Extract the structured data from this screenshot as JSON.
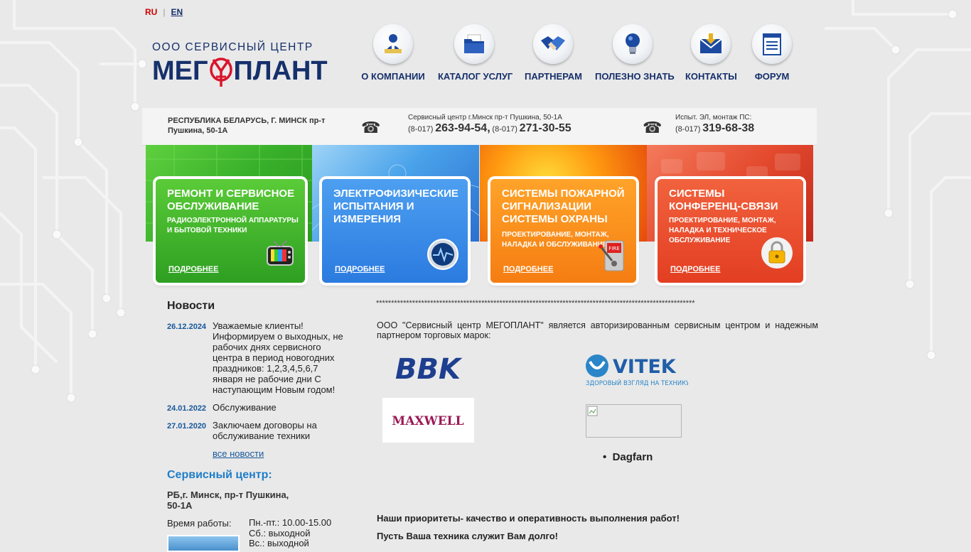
{
  "lang": {
    "ru": "RU",
    "en": "EN"
  },
  "logo": {
    "top": "ООО СЕРВИСНЫЙ ЦЕНТР",
    "left": "МЕГ",
    "right": "ПЛАНТ"
  },
  "nav": [
    {
      "label": "О КОМПАНИИ",
      "icon": "presenter-icon"
    },
    {
      "label": "КАТАЛОГ УСЛУГ",
      "icon": "folder-icon"
    },
    {
      "label": "ПАРТНЕРАМ",
      "icon": "handshake-icon"
    },
    {
      "label": "ПОЛЕЗНО ЗНАТЬ",
      "icon": "lightbulb-icon"
    },
    {
      "label": "КОНТАКТЫ",
      "icon": "mail-icon"
    },
    {
      "label": "ФОРУМ",
      "icon": "notepad-icon"
    }
  ],
  "info": {
    "address": "РЕСПУБЛИКА БЕЛАРУСЬ, Г. МИНСК пр-т Пушкина, 50-1А",
    "service_title": "Сервисный центр г.Минск пр-т Пушкина, 50-1А",
    "service_code1": "(8-017)",
    "service_num1": "263-94-54,",
    "service_code2": "(8-017)",
    "service_num2": "271-30-55",
    "test_title": "Испыт. ЭЛ, монтаж ПС:",
    "test_code": "(8-017)",
    "test_num": "319-68-38"
  },
  "cards": [
    {
      "title": "РЕМОНТ И СЕРВИСНОЕ ОБСЛУЖИВАНИЕ",
      "sub": "РАДИОЭЛЕКТРОННОЙ АППАРАТУРЫ И БЫТОВОЙ ТЕХНИКИ",
      "more": "ПОДРОБНЕЕ",
      "icon": "tv-icon"
    },
    {
      "title": "ЭЛЕКТРОФИЗИЧЕСКИЕ ИСПЫТАНИЯ И ИЗМЕРЕНИЯ",
      "sub": "",
      "more": "ПОДРОБНЕЕ",
      "icon": "oscilloscope-icon"
    },
    {
      "title": "СИСТЕМЫ ПОЖАРНОЙ СИГНАЛИЗАЦИИ СИСТЕМЫ ОХРАНЫ",
      "sub": "ПРОЕКТИРОВАНИЕ, МОНТАЖ, НАЛАДКА И ОБСЛУЖИВАНИЕ",
      "more": "ПОДРОБНЕЕ",
      "icon": "fire-alarm-icon",
      "icon_text": "FIRE"
    },
    {
      "title": "СИСТЕМЫ КОНФЕРЕНЦ-СВЯЗИ",
      "sub": "ПРОЕКТИРОВАНИЕ, МОНТАЖ, НАЛАДКА И ТЕХНИЧЕСКОЕ ОБСЛУЖИВАНИЕ",
      "more": "ПОДРОБНЕЕ",
      "icon": "padlock-icon"
    }
  ],
  "news": {
    "heading": "Новости",
    "items": [
      {
        "date": "26.12.2024",
        "text": "Уважаемые клиенты! Информируем о выходных, не рабочих днях сервисного центра в период новогодних праздников: 1,2,3,4,5,6,7 января не рабочие дни С наступающим Новым годом!"
      },
      {
        "date": "24.01.2022",
        "text": "Обслуживание"
      },
      {
        "date": "27.01.2020",
        "text": "Заключаем договоры на обслуживание техники"
      }
    ],
    "all": "все новости"
  },
  "service_center": {
    "heading": "Сервисный центр:",
    "address": "РБ,г. Минск, пр-т Пушкина, 50-1А",
    "hours_label": "Время работы:",
    "hours": [
      "Пн.-пт.: 10.00-15.00",
      "Сб.: выходной",
      "Вс.: выходной"
    ]
  },
  "main": {
    "stars": "**********************************************************************************************************",
    "intro": "ООО \"Сервисный центр МЕГОПЛАНТ\" является авторизированным сервисным центром и надежным партнером  торговых марок:",
    "brands": {
      "bbk": "BBK",
      "vitek": "VITEK",
      "vitek_slogan": "ЗДОРОВЫЙ ВЗГЛЯД НА ТЕХНИКУ",
      "maxwell": "MAXWELL",
      "dagfarn": "Dagfarn"
    },
    "priority1": "Наши приоритеты- качество и оперативность выполнения работ!",
    "priority2": "Пусть Ваша техника служит Вам долго!"
  },
  "colors": {
    "brand": "#16306b",
    "link": "#16579b",
    "accent_red": "#cc0000",
    "green": "#3fae29",
    "blue": "#3f8fe0",
    "orange": "#f39a14",
    "red": "#e8452a"
  }
}
